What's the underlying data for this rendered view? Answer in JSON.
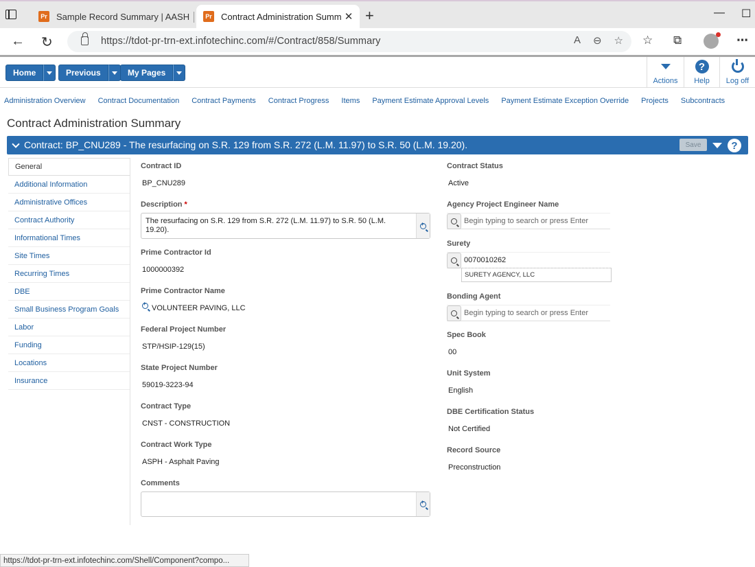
{
  "browser": {
    "tabs": [
      {
        "favicon": "Pr",
        "title": "Sample Record Summary | AASH"
      },
      {
        "favicon": "Pr",
        "title": "Contract Administration Summar"
      }
    ],
    "url": "https://tdot-pr-trn-ext.infotechinc.com/#/Contract/858/Summary",
    "status_url": "https://tdot-pr-trn-ext.infotechinc.com/Shell/Component?compo..."
  },
  "header": {
    "home": "Home",
    "previous": "Previous",
    "my_pages": "My Pages",
    "actions": "Actions",
    "help": "Help",
    "logoff": "Log off"
  },
  "subnav": [
    "Administration Overview",
    "Contract Documentation",
    "Contract Payments",
    "Contract Progress",
    "Items",
    "Payment Estimate Approval Levels",
    "Payment Estimate Exception Override",
    "Projects",
    "Subcontracts"
  ],
  "page_title": "Contract Administration Summary",
  "contract_bar": {
    "title": "Contract: BP_CNU289 - The resurfacing on S.R. 129 from S.R. 272 (L.M. 11.97) to S.R. 50 (L.M. 19.20).",
    "save": "Save",
    "help": "?"
  },
  "left_menu": [
    "General",
    "Additional Information",
    "Administrative Offices",
    "Contract Authority",
    "Informational Times",
    "Site Times",
    "Recurring Times",
    "DBE",
    "Small Business Program Goals",
    "Labor",
    "Funding",
    "Locations",
    "Insurance"
  ],
  "form": {
    "contract_id": {
      "label": "Contract ID",
      "value": "BP_CNU289"
    },
    "description": {
      "label": "Description",
      "required": "*",
      "value": "The resurfacing on S.R. 129 from S.R. 272 (L.M. 11.97) to S.R. 50 (L.M. 19.20)."
    },
    "prime_contractor_id": {
      "label": "Prime Contractor Id",
      "value": "1000000392"
    },
    "prime_contractor_name": {
      "label": "Prime Contractor Name",
      "value": "VOLUNTEER PAVING, LLC"
    },
    "federal_project_number": {
      "label": "Federal Project Number",
      "value": "STP/HSIP-129(15)"
    },
    "state_project_number": {
      "label": "State Project Number",
      "value": "59019-3223-94"
    },
    "contract_type": {
      "label": "Contract Type",
      "value": "CNST - CONSTRUCTION"
    },
    "contract_work_type": {
      "label": "Contract Work Type",
      "value": "ASPH - Asphalt Paving"
    },
    "comments": {
      "label": "Comments",
      "value": ""
    },
    "contract_status": {
      "label": "Contract Status",
      "value": "Active"
    },
    "agency_project_engineer": {
      "label": "Agency Project Engineer Name",
      "placeholder": "Begin typing to search or press Enter"
    },
    "surety": {
      "label": "Surety",
      "value": "0070010262",
      "sub": "SURETY AGENCY, LLC"
    },
    "bonding_agent": {
      "label": "Bonding Agent",
      "placeholder": "Begin typing to search or press Enter"
    },
    "spec_book": {
      "label": "Spec Book",
      "value": "00"
    },
    "unit_system": {
      "label": "Unit System",
      "value": "English"
    },
    "dbe_certification_status": {
      "label": "DBE Certification Status",
      "value": "Not Certified"
    },
    "record_source": {
      "label": "Record Source",
      "value": "Preconstruction"
    }
  }
}
